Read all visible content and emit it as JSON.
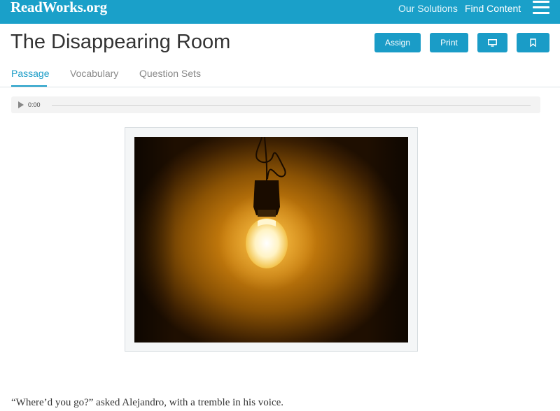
{
  "header": {
    "logo": "ReadWorks.org",
    "nav": {
      "solutions": "Our Solutions",
      "find_content": "Find Content"
    },
    "menu_icon": "hamburger-icon",
    "brand_color": "#1aa0c9"
  },
  "article": {
    "title": "The Disappearing Room",
    "actions": {
      "assign": "Assign",
      "print": "Print",
      "monitor_icon": "monitor-icon",
      "bookmark_icon": "bookmark-icon"
    }
  },
  "tabs": [
    {
      "label": "Passage",
      "active": true
    },
    {
      "label": "Vocabulary",
      "active": false
    },
    {
      "label": "Question Sets",
      "active": false
    }
  ],
  "audio": {
    "time": "0:00",
    "play_icon": "play-icon"
  },
  "passage": {
    "first_line": "“Where’d you go?” asked Alejandro, with a tremble in his voice."
  }
}
